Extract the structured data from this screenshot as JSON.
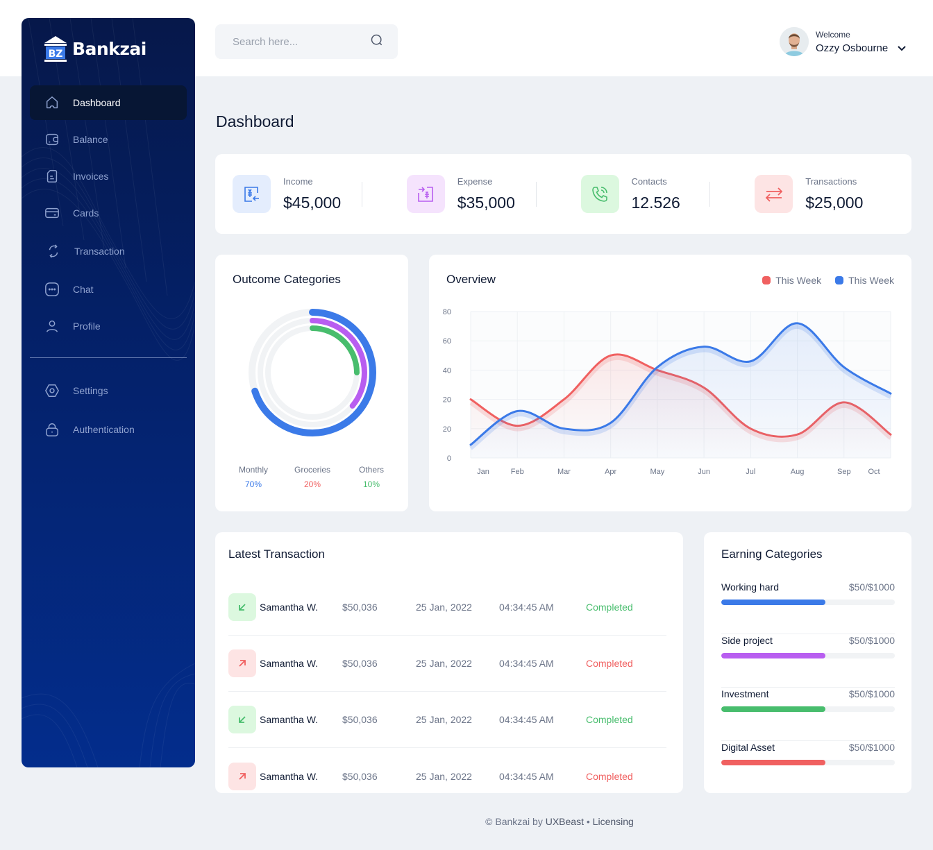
{
  "brand": {
    "name": "Bankzai",
    "monogram": "BZ"
  },
  "sidebar": {
    "items": [
      {
        "label": "Dashboard",
        "icon": "home-icon",
        "active": true
      },
      {
        "label": "Balance",
        "icon": "wallet-icon"
      },
      {
        "label": "Invoices",
        "icon": "invoice-icon"
      },
      {
        "label": "Cards",
        "icon": "card-icon"
      },
      {
        "label": "Transaction",
        "icon": "transaction-icon"
      },
      {
        "label": "Chat",
        "icon": "chat-icon"
      },
      {
        "label": "Profile",
        "icon": "user-icon"
      }
    ],
    "bottom_items": [
      {
        "label": "Settings",
        "icon": "settings-icon"
      },
      {
        "label": "Authentication",
        "icon": "lock-icon"
      }
    ]
  },
  "search": {
    "placeholder": "Search here...",
    "value": ""
  },
  "user": {
    "welcome": "Welcome",
    "name": "Ozzy Osbourne"
  },
  "page_title": "Dashboard",
  "stats": [
    {
      "label": "Income",
      "value": "$45,000",
      "icon": "income-icon",
      "color": "#3b7ae8",
      "bg": "#e4edfd"
    },
    {
      "label": "Expense",
      "value": "$35,000",
      "icon": "expense-icon",
      "color": "#b85ef0",
      "bg": "#f5e3fd"
    },
    {
      "label": "Contacts",
      "value": "12.526",
      "icon": "phone-icon",
      "color": "#48bd6d",
      "bg": "#dcf8df"
    },
    {
      "label": "Transactions",
      "value": "$25,000",
      "icon": "transfer-icon",
      "color": "#f06060",
      "bg": "#fde4e4"
    }
  ],
  "outcome": {
    "title": "Outcome Categories",
    "categories": [
      {
        "label": "Monthly",
        "percent_text": "70%",
        "value": 70,
        "color": "#3b7ae8"
      },
      {
        "label": "Groceries",
        "percent_text": "20%",
        "value": 20,
        "color": "#f06060"
      },
      {
        "label": "Others",
        "percent_text": "10%",
        "value": 10,
        "color": "#48bd6d"
      }
    ],
    "rings": [
      {
        "fraction": 0.7,
        "color": "#3b7ae8"
      },
      {
        "fraction": 0.36,
        "color": "#b85ef0"
      },
      {
        "fraction": 0.25,
        "color": "#48bd6d"
      }
    ]
  },
  "overview": {
    "title": "Overview"
  },
  "chart_data": {
    "type": "line",
    "title": "Overview",
    "x": [
      "Jan",
      "Feb",
      "Mar",
      "Apr",
      "May",
      "Jun",
      "Jul",
      "Aug",
      "Sep",
      "Oct"
    ],
    "y_tick_labels": [
      "0",
      "20",
      "20",
      "40",
      "60",
      "80"
    ],
    "ylim": [
      0,
      100
    ],
    "grid": true,
    "legend_position": "top-right",
    "series": [
      {
        "name": "This Week",
        "color": "#f06060",
        "values": [
          40,
          22,
          40,
          70,
          60,
          48,
          20,
          16,
          38,
          16
        ]
      },
      {
        "name": "This Week",
        "color": "#3b7ae8",
        "values": [
          9,
          32,
          20,
          24,
          62,
          76,
          66,
          92,
          62,
          44
        ]
      }
    ]
  },
  "latest": {
    "title": "Latest Transaction",
    "rows": [
      {
        "direction": "in",
        "name": "Samantha W.",
        "amount": "$50,036",
        "date": "25 Jan, 2022",
        "time": "04:34:45 AM",
        "status": "Completed",
        "status_color": "#48bd6d"
      },
      {
        "direction": "out",
        "name": "Samantha W.",
        "amount": "$50,036",
        "date": "25 Jan, 2022",
        "time": "04:34:45 AM",
        "status": "Completed",
        "status_color": "#f06060"
      },
      {
        "direction": "in",
        "name": "Samantha W.",
        "amount": "$50,036",
        "date": "25 Jan, 2022",
        "time": "04:34:45 AM",
        "status": "Completed",
        "status_color": "#48bd6d"
      },
      {
        "direction": "out",
        "name": "Samantha W.",
        "amount": "$50,036",
        "date": "25 Jan, 2022",
        "time": "04:34:45 AM",
        "status": "Completed",
        "status_color": "#f06060"
      }
    ]
  },
  "earning": {
    "title": "Earning Categories",
    "items": [
      {
        "label": "Working hard",
        "value": "$50/$1000",
        "progress": 0.6,
        "color": "#3b7ae8"
      },
      {
        "label": "Side project",
        "value": "$50/$1000",
        "progress": 0.6,
        "color": "#b85ef0"
      },
      {
        "label": "Investment",
        "value": "$50/$1000",
        "progress": 0.6,
        "color": "#48bd6d"
      },
      {
        "label": "Digital Asset",
        "value": "$50/$1000",
        "progress": 0.6,
        "color": "#f06060"
      }
    ]
  },
  "footer": {
    "copyright": "© Bankzai by",
    "author": "UXBeast",
    "separator": "•",
    "link": "Licensing"
  }
}
